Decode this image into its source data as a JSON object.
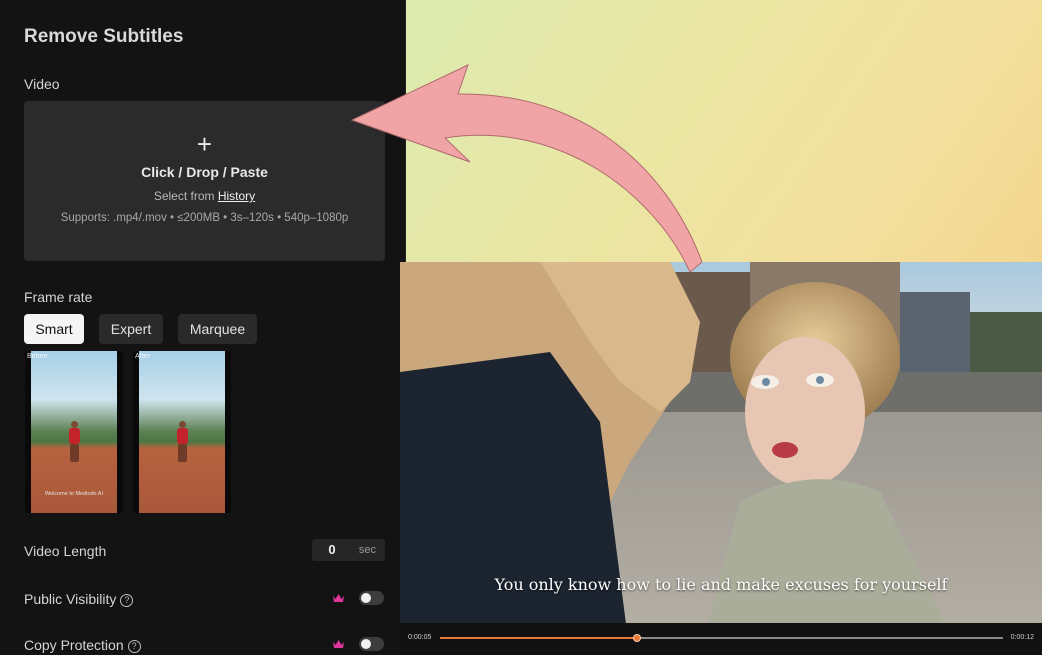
{
  "panel": {
    "title": "Remove Subtitles",
    "video_label": "Video",
    "upload": {
      "plus": "+",
      "primary": "Click / Drop / Paste",
      "select_prefix": "Select from",
      "history_link": "History",
      "supports": "Supports: .mp4/.mov • ≤200MB • 3s–120s • 540p–1080p"
    },
    "frame_rate_label": "Frame rate",
    "modes": [
      "Smart",
      "Expert",
      "Marquee"
    ],
    "active_mode": "Smart",
    "preview": {
      "before_tag": "Before",
      "after_tag": "After",
      "before_subtitle": "Welcome to Mediodo AI"
    },
    "video_length": {
      "label": "Video Length",
      "value": "0",
      "unit": "sec"
    },
    "public_visibility": {
      "label": "Public Visibility",
      "help": "?",
      "enabled": false
    },
    "copy_protection": {
      "label": "Copy Protection",
      "help": "?",
      "enabled": false
    }
  },
  "player": {
    "caption": "You only know how to lie and make excuses for yourself",
    "current_time": "0:00:05",
    "total_time": "0:00:12",
    "progress": 0.35
  },
  "colors": {
    "accent": "#e6783c",
    "crown": "#e0359a",
    "arrow": "#f0a4a6"
  }
}
